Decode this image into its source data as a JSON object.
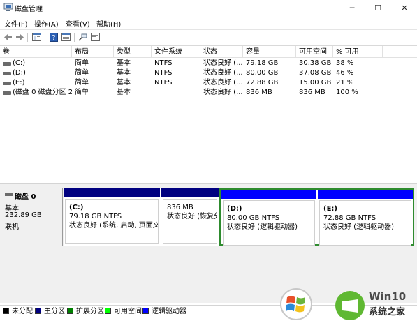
{
  "window": {
    "title": "磁盘管理",
    "minimize_glyph": "─",
    "maximize_glyph": "☐",
    "close_glyph": "✕"
  },
  "menu": {
    "items": [
      "文件(F)",
      "操作(A)",
      "查看(V)",
      "帮助(H)"
    ]
  },
  "toolbar": {
    "icons": [
      "back-icon",
      "forward-icon",
      "properties-icon",
      "help-icon",
      "refresh-icon",
      "connect-icon",
      "console-icon"
    ]
  },
  "volumes": {
    "columns": [
      "卷",
      "布局",
      "类型",
      "文件系统",
      "状态",
      "容量",
      "可用空间",
      "% 可用"
    ],
    "rows": [
      {
        "name": "(C:)",
        "layout": "简单",
        "type": "基本",
        "fs": "NTFS",
        "status": "状态良好 (...",
        "capacity": "79.18 GB",
        "free": "30.38 GB",
        "pct": "38 %"
      },
      {
        "name": "(D:)",
        "layout": "简单",
        "type": "基本",
        "fs": "NTFS",
        "status": "状态良好 (...",
        "capacity": "80.00 GB",
        "free": "37.08 GB",
        "pct": "46 %"
      },
      {
        "name": "(E:)",
        "layout": "简单",
        "type": "基本",
        "fs": "NTFS",
        "status": "状态良好 (...",
        "capacity": "72.88 GB",
        "free": "15.00 GB",
        "pct": "21 %"
      },
      {
        "name": "(磁盘 0 磁盘分区 2)",
        "layout": "简单",
        "type": "基本",
        "fs": "",
        "status": "状态良好 (...",
        "capacity": "836 MB",
        "free": "836 MB",
        "pct": "100 %"
      }
    ]
  },
  "disk": {
    "name": "磁盘 0",
    "type": "基本",
    "size": "232.89 GB",
    "state": "联机",
    "partitions": [
      {
        "label": "(C:)",
        "size": "79.18 GB NTFS",
        "status": "状态良好 (系统, 启动, 页面文件"
      },
      {
        "label": "",
        "size": "836 MB",
        "status": "状态良好 (恢复分"
      },
      {
        "label": "(D:)",
        "size": "80.00 GB NTFS",
        "status": "状态良好 (逻辑驱动器)"
      },
      {
        "label": "(E:)",
        "size": "72.88 GB NTFS",
        "status": "状态良好 (逻辑驱动器)"
      }
    ]
  },
  "legend": [
    {
      "label": "未分配",
      "color": "#000000"
    },
    {
      "label": "主分区",
      "color": "#000080"
    },
    {
      "label": "扩展分区",
      "color": "#008000"
    },
    {
      "label": "可用空间",
      "color": "#00ff00"
    },
    {
      "label": "逻辑驱动器",
      "color": "#0000ff"
    }
  ],
  "colors": {
    "primary_bar": "#000080",
    "logical_bar": "#0000ff",
    "extended_border": "#2e8b2e"
  },
  "watermark": {
    "brand": "Win10",
    "subtitle": "系统之家"
  }
}
